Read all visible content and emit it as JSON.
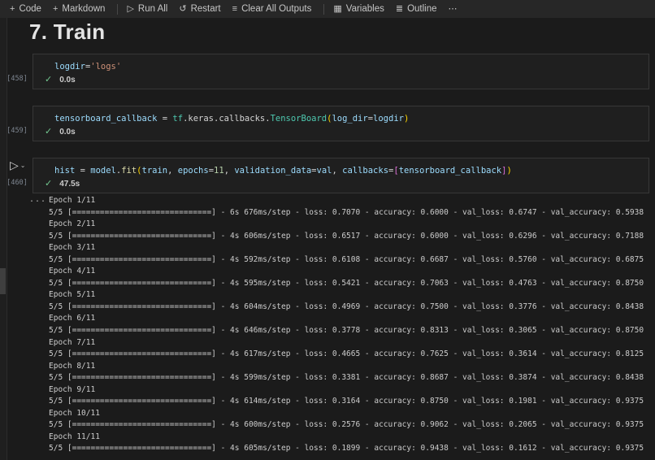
{
  "colors": {
    "background": "#1b1b1b",
    "toolbar_bg": "#272727",
    "cell_bg": "#1f1f1f",
    "cell_border": "#373737",
    "token_variable": "#9CDCFE",
    "token_string": "#CE9178",
    "token_class": "#4EC9B0",
    "token_function": "#DCDCAA",
    "token_number": "#B5CEA8",
    "bracket_round": "#FFD700",
    "bracket_square": "#DA70D6",
    "check_green": "#73c991",
    "output_text": "#cccccc"
  },
  "toolbar": {
    "items": [
      {
        "name": "add-code",
        "icon": "plus",
        "label": "Code"
      },
      {
        "name": "add-markdown",
        "icon": "plus",
        "label": "Markdown"
      },
      {
        "sep": true
      },
      {
        "name": "run-all",
        "icon": "play",
        "label": "Run All"
      },
      {
        "name": "restart",
        "icon": "restart",
        "label": "Restart"
      },
      {
        "name": "clear-all-outputs",
        "icon": "clear",
        "label": "Clear All Outputs"
      },
      {
        "sep": true
      },
      {
        "name": "variables",
        "icon": "variables",
        "label": "Variables"
      },
      {
        "name": "outline",
        "icon": "outline",
        "label": "Outline"
      },
      {
        "name": "more-actions",
        "icon": "more",
        "label": ""
      }
    ],
    "icon_glyphs": {
      "plus": "+",
      "play": "▷",
      "restart": "↺",
      "clear": "≡",
      "variables": "▦",
      "outline": "≣",
      "more": "⋯"
    }
  },
  "heading": {
    "text": "7. Train"
  },
  "cells": [
    {
      "exec_label": "[458]",
      "time": "0.0s",
      "code": "logdir='logs'",
      "tokens": [
        {
          "t": "logdir",
          "c": "var"
        },
        {
          "t": "=",
          "c": "op"
        },
        {
          "t": "'logs'",
          "c": "str"
        }
      ]
    },
    {
      "exec_label": "[459]",
      "time": "0.0s",
      "code": "tensorboard_callback = tf.keras.callbacks.TensorBoard(log_dir=logdir)",
      "tokens": [
        {
          "t": "tensorboard_callback",
          "c": "var"
        },
        {
          "t": " = ",
          "c": "op"
        },
        {
          "t": "tf",
          "c": "cls"
        },
        {
          "t": ".",
          "c": "op"
        },
        {
          "t": "keras",
          "c": "op"
        },
        {
          "t": ".",
          "c": "op"
        },
        {
          "t": "callbacks",
          "c": "op"
        },
        {
          "t": ".",
          "c": "op"
        },
        {
          "t": "TensorBoard",
          "c": "cls"
        },
        {
          "t": "(",
          "c": "b1"
        },
        {
          "t": "log_dir",
          "c": "var"
        },
        {
          "t": "=",
          "c": "op"
        },
        {
          "t": "logdir",
          "c": "var"
        },
        {
          "t": ")",
          "c": "b1"
        }
      ]
    },
    {
      "exec_label": "[460]",
      "time": "47.5s",
      "has_run_button": true,
      "code": "hist = model.fit(train, epochs=11, validation_data=val, callbacks=[tensorboard_callback])",
      "tokens": [
        {
          "t": "hist",
          "c": "var"
        },
        {
          "t": " = ",
          "c": "op"
        },
        {
          "t": "model",
          "c": "var"
        },
        {
          "t": ".",
          "c": "op"
        },
        {
          "t": "fit",
          "c": "fn"
        },
        {
          "t": "(",
          "c": "b1"
        },
        {
          "t": "train",
          "c": "var"
        },
        {
          "t": ", ",
          "c": "op"
        },
        {
          "t": "epochs",
          "c": "var"
        },
        {
          "t": "=",
          "c": "op"
        },
        {
          "t": "11",
          "c": "num"
        },
        {
          "t": ", ",
          "c": "op"
        },
        {
          "t": "validation_data",
          "c": "var"
        },
        {
          "t": "=",
          "c": "op"
        },
        {
          "t": "val",
          "c": "var"
        },
        {
          "t": ", ",
          "c": "op"
        },
        {
          "t": "callbacks",
          "c": "var"
        },
        {
          "t": "=",
          "c": "op"
        },
        {
          "t": "[",
          "c": "b2"
        },
        {
          "t": "tensorboard_callback",
          "c": "var"
        },
        {
          "t": "]",
          "c": "b2"
        },
        {
          "t": ")",
          "c": "b1"
        }
      ]
    }
  ],
  "output": {
    "collapse_indicator": "...",
    "steps_label": "5/5",
    "progress_bar": "[==============================]",
    "total_epochs": 11,
    "epochs": [
      {
        "epoch": 1,
        "duration": "6s",
        "step_time": "676ms/step",
        "loss": "0.7070",
        "accuracy": "0.6000",
        "val_loss": "0.6747",
        "val_accuracy": "0.5938"
      },
      {
        "epoch": 2,
        "duration": "4s",
        "step_time": "606ms/step",
        "loss": "0.6517",
        "accuracy": "0.6000",
        "val_loss": "0.6296",
        "val_accuracy": "0.7188"
      },
      {
        "epoch": 3,
        "duration": "4s",
        "step_time": "592ms/step",
        "loss": "0.6108",
        "accuracy": "0.6687",
        "val_loss": "0.5760",
        "val_accuracy": "0.6875"
      },
      {
        "epoch": 4,
        "duration": "4s",
        "step_time": "595ms/step",
        "loss": "0.5421",
        "accuracy": "0.7063",
        "val_loss": "0.4763",
        "val_accuracy": "0.8750"
      },
      {
        "epoch": 5,
        "duration": "4s",
        "step_time": "604ms/step",
        "loss": "0.4969",
        "accuracy": "0.7500",
        "val_loss": "0.3776",
        "val_accuracy": "0.8438"
      },
      {
        "epoch": 6,
        "duration": "4s",
        "step_time": "646ms/step",
        "loss": "0.3778",
        "accuracy": "0.8313",
        "val_loss": "0.3065",
        "val_accuracy": "0.8750"
      },
      {
        "epoch": 7,
        "duration": "4s",
        "step_time": "617ms/step",
        "loss": "0.4665",
        "accuracy": "0.7625",
        "val_loss": "0.3614",
        "val_accuracy": "0.8125"
      },
      {
        "epoch": 8,
        "duration": "4s",
        "step_time": "599ms/step",
        "loss": "0.3381",
        "accuracy": "0.8687",
        "val_loss": "0.3874",
        "val_accuracy": "0.8438"
      },
      {
        "epoch": 9,
        "duration": "4s",
        "step_time": "614ms/step",
        "loss": "0.3164",
        "accuracy": "0.8750",
        "val_loss": "0.1981",
        "val_accuracy": "0.9375"
      },
      {
        "epoch": 10,
        "duration": "4s",
        "step_time": "600ms/step",
        "loss": "0.2576",
        "accuracy": "0.9062",
        "val_loss": "0.2065",
        "val_accuracy": "0.9375"
      },
      {
        "epoch": 11,
        "duration": "4s",
        "step_time": "605ms/step",
        "loss": "0.1899",
        "accuracy": "0.9438",
        "val_loss": "0.1612",
        "val_accuracy": "0.9375"
      }
    ]
  }
}
